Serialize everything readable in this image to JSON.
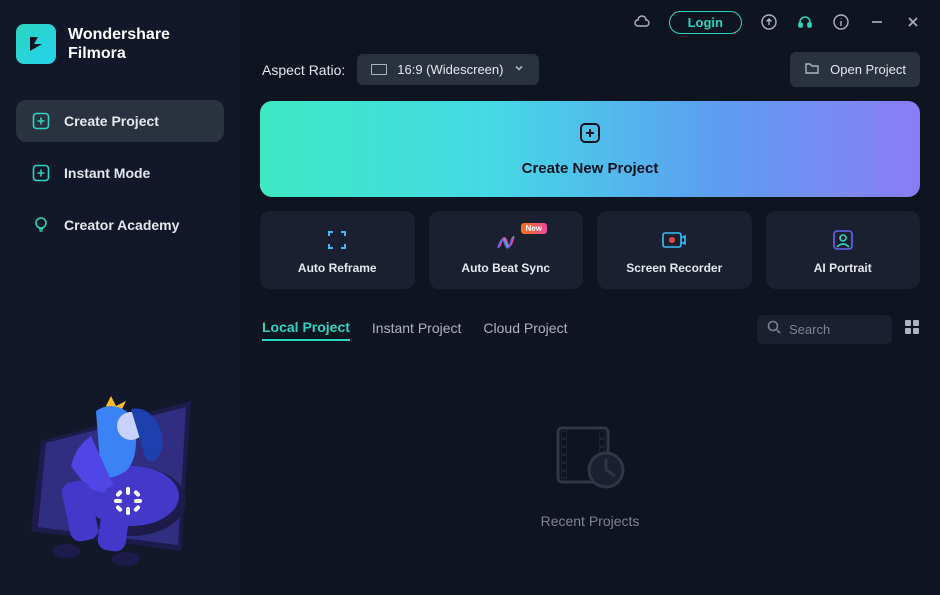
{
  "brand": {
    "line1": "Wondershare",
    "line2": "Filmora"
  },
  "sidebar": {
    "items": [
      {
        "label": "Create Project",
        "icon": "plus-square"
      },
      {
        "label": "Instant Mode",
        "icon": "plus-square-outline"
      },
      {
        "label": "Creator Academy",
        "icon": "bulb"
      }
    ]
  },
  "titlebar": {
    "login": "Login"
  },
  "aspect": {
    "label": "Aspect Ratio:",
    "value": "16:9 (Widescreen)"
  },
  "openProject": "Open Project",
  "hero": {
    "label": "Create New Project"
  },
  "cards": [
    {
      "label": "Auto Reframe",
      "icon": "reframe",
      "badge": ""
    },
    {
      "label": "Auto Beat Sync",
      "icon": "beat",
      "badge": "New"
    },
    {
      "label": "Screen Recorder",
      "icon": "recorder",
      "badge": ""
    },
    {
      "label": "AI Portrait",
      "icon": "portrait",
      "badge": ""
    }
  ],
  "projectTabs": [
    {
      "label": "Local Project"
    },
    {
      "label": "Instant Project"
    },
    {
      "label": "Cloud Project"
    }
  ],
  "search": {
    "placeholder": "Search"
  },
  "recent": {
    "label": "Recent Projects"
  }
}
